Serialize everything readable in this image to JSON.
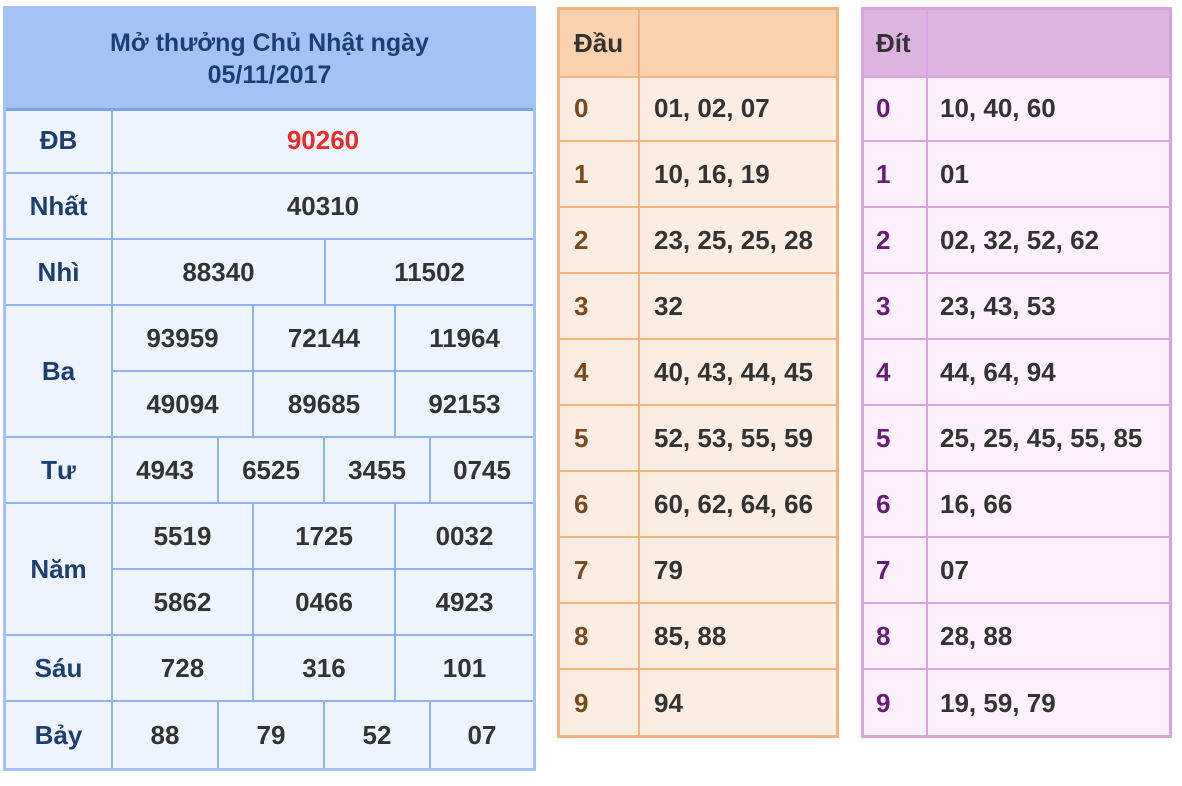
{
  "results": {
    "title_line1": "Mở thưởng Chủ Nhật ngày",
    "title_line2": "05/11/2017",
    "labels": {
      "db": "ĐB",
      "nhat": "Nhất",
      "nhi": "Nhì",
      "ba": "Ba",
      "tu": "Tư",
      "nam": "Năm",
      "sau": "Sáu",
      "bay": "Bảy"
    },
    "db": [
      "90260"
    ],
    "nhat": [
      "40310"
    ],
    "nhi": [
      "88340",
      "11502"
    ],
    "ba": [
      "93959",
      "72144",
      "11964",
      "49094",
      "89685",
      "92153"
    ],
    "tu": [
      "4943",
      "6525",
      "3455",
      "0745"
    ],
    "nam": [
      "5519",
      "1725",
      "0032",
      "5862",
      "0466",
      "4923"
    ],
    "sau": [
      "728",
      "316",
      "101"
    ],
    "bay": [
      "88",
      "79",
      "52",
      "07"
    ],
    "db_color": "#e82b2b"
  },
  "dau": {
    "header": "Đầu",
    "rows": [
      {
        "k": "0",
        "v": "01, 02, 07"
      },
      {
        "k": "1",
        "v": "10, 16, 19"
      },
      {
        "k": "2",
        "v": "23, 25, 25, 28"
      },
      {
        "k": "3",
        "v": "32"
      },
      {
        "k": "4",
        "v": "40, 43, 44, 45"
      },
      {
        "k": "5",
        "v": "52, 53, 55, 59"
      },
      {
        "k": "6",
        "v": "60, 62, 64, 66"
      },
      {
        "k": "7",
        "v": "79"
      },
      {
        "k": "8",
        "v": "85, 88"
      },
      {
        "k": "9",
        "v": "94"
      }
    ]
  },
  "dit": {
    "header": "Đít",
    "rows": [
      {
        "k": "0",
        "v": "10, 40, 60"
      },
      {
        "k": "1",
        "v": "01"
      },
      {
        "k": "2",
        "v": "02, 32, 52, 62"
      },
      {
        "k": "3",
        "v": "23, 43, 53"
      },
      {
        "k": "4",
        "v": "44, 64, 94"
      },
      {
        "k": "5",
        "v": "25, 25, 45, 55, 85"
      },
      {
        "k": "6",
        "v": "16, 66"
      },
      {
        "k": "7",
        "v": "07"
      },
      {
        "k": "8",
        "v": "28, 88"
      },
      {
        "k": "9",
        "v": "19, 59, 79"
      }
    ]
  }
}
